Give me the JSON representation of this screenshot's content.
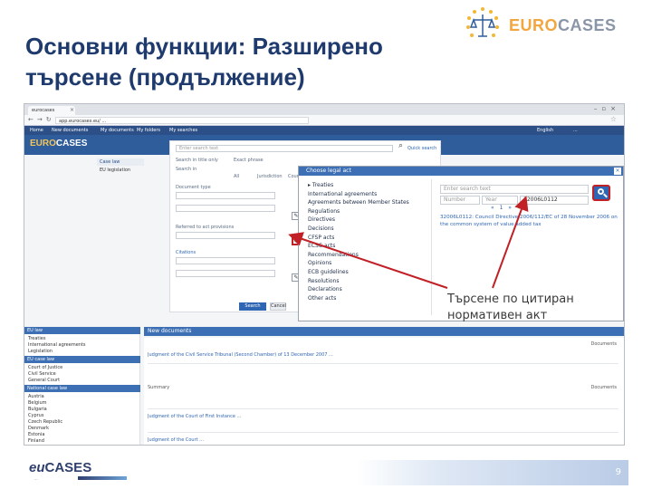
{
  "slide": {
    "title": "Основни функции: Разширено търсене (продължение)",
    "page_number": "9",
    "callout": "Търсене по цитиран нормативен акт"
  },
  "logo_top": {
    "brand_euro": "EURO",
    "brand_cases": "CASES"
  },
  "logo_bottom": {
    "brand_eu": "eu",
    "brand_cases": "CASES",
    "tagline": "..."
  },
  "browser": {
    "tab_label": "eurocases",
    "url": "app.eurocases.eu/ ...",
    "nav_items": [
      "Home",
      "New documents",
      "My documents",
      "My folders",
      "My searches"
    ],
    "lang": "English",
    "user": "..."
  },
  "app": {
    "left_nav": {
      "case_law": "Case law",
      "eu_legislation": "EU legislation"
    }
  },
  "search_panel": {
    "field_placeholder": "Enter search text",
    "quick_search": "Quick search",
    "search_only": "Search in title only",
    "exact_phrase": "Exact phrase",
    "search_in": "Search in",
    "all": "All",
    "jurisdiction": "Jurisdiction",
    "court": "Court",
    "documents_type": "Document type",
    "referenced_act": "Referred to act provisions",
    "citations": "Citations",
    "search_btn": "Search",
    "cancel_btn": "Cancel"
  },
  "modal": {
    "title": "Choose legal act",
    "tree_items": [
      "Treaties",
      "International agreements",
      "Agreements between Member States",
      "Regulations",
      "Directives",
      "Decisions",
      "CFSP acts",
      "ECSC acts",
      "Recommendations",
      "Opinions",
      "ECB guidelines",
      "Resolutions",
      "Declarations",
      "Other acts"
    ],
    "search_placeholder": "Enter search text",
    "number_label": "Number",
    "year_label": "Year",
    "celex_value": "32006L0112",
    "pager": "« 1 »",
    "result_text": "32006L0112: Council Directive 2006/112/EC of 28 November 2006 on the common system of value added tax"
  },
  "new_documents": {
    "header": "New documents",
    "left_sections": [
      {
        "title": "EU law",
        "items": [
          "Treaties",
          "International agreements",
          "Legislation"
        ]
      },
      {
        "title": "EU case law",
        "items": [
          "Court of Justice",
          "Civil Service",
          "General Court"
        ]
      },
      {
        "title": "National case law",
        "items": [
          "Austria",
          "Belgium",
          "Bulgaria",
          "Cyprus",
          "Czech Republic",
          "Denmark",
          "Estonia",
          "Finland"
        ]
      }
    ],
    "docs": [
      {
        "title": "Judgment of the Civil Service Tribunal (Second Chamber) of 13 December 2007 ...",
        "right": "Documents"
      },
      {
        "title": "Summary",
        "right": "Documents"
      },
      {
        "title": "Judgment of the Court of First Instance ...",
        "right": ""
      },
      {
        "title": "Judgment of the Court ...",
        "right": ""
      }
    ]
  }
}
